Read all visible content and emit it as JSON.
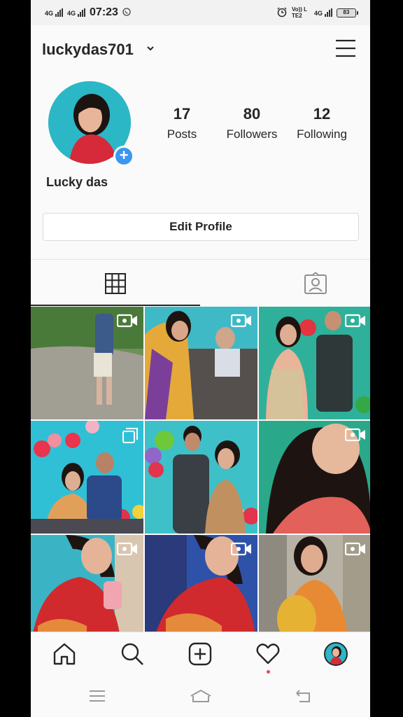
{
  "status_bar": {
    "net1": "4G",
    "net2": "4G",
    "time": "07:23",
    "volte": "Vo)) LTE2",
    "net3": "4G",
    "battery": "83"
  },
  "header": {
    "username": "luckydas701"
  },
  "profile": {
    "full_name": "Lucky das",
    "stats": [
      {
        "value": "17",
        "label": "Posts"
      },
      {
        "value": "80",
        "label": "Followers"
      },
      {
        "value": "12",
        "label": "Following"
      }
    ],
    "edit_label": "Edit Profile"
  },
  "tabs": [
    {
      "icon": "grid-icon",
      "active": true
    },
    {
      "icon": "tagged-icon",
      "active": false
    }
  ],
  "posts": [
    {
      "type": "video"
    },
    {
      "type": "video"
    },
    {
      "type": "video"
    },
    {
      "type": "carousel"
    },
    {
      "type": "photo"
    },
    {
      "type": "video"
    },
    {
      "type": "video"
    },
    {
      "type": "video"
    },
    {
      "type": "video"
    }
  ],
  "bottom_nav": [
    "home-icon",
    "search-icon",
    "add-post-icon",
    "heart-icon",
    "profile-avatar"
  ],
  "colors": {
    "accent_blue": "#3897f0",
    "notification_red": "#ed4956",
    "text": "#262626"
  }
}
